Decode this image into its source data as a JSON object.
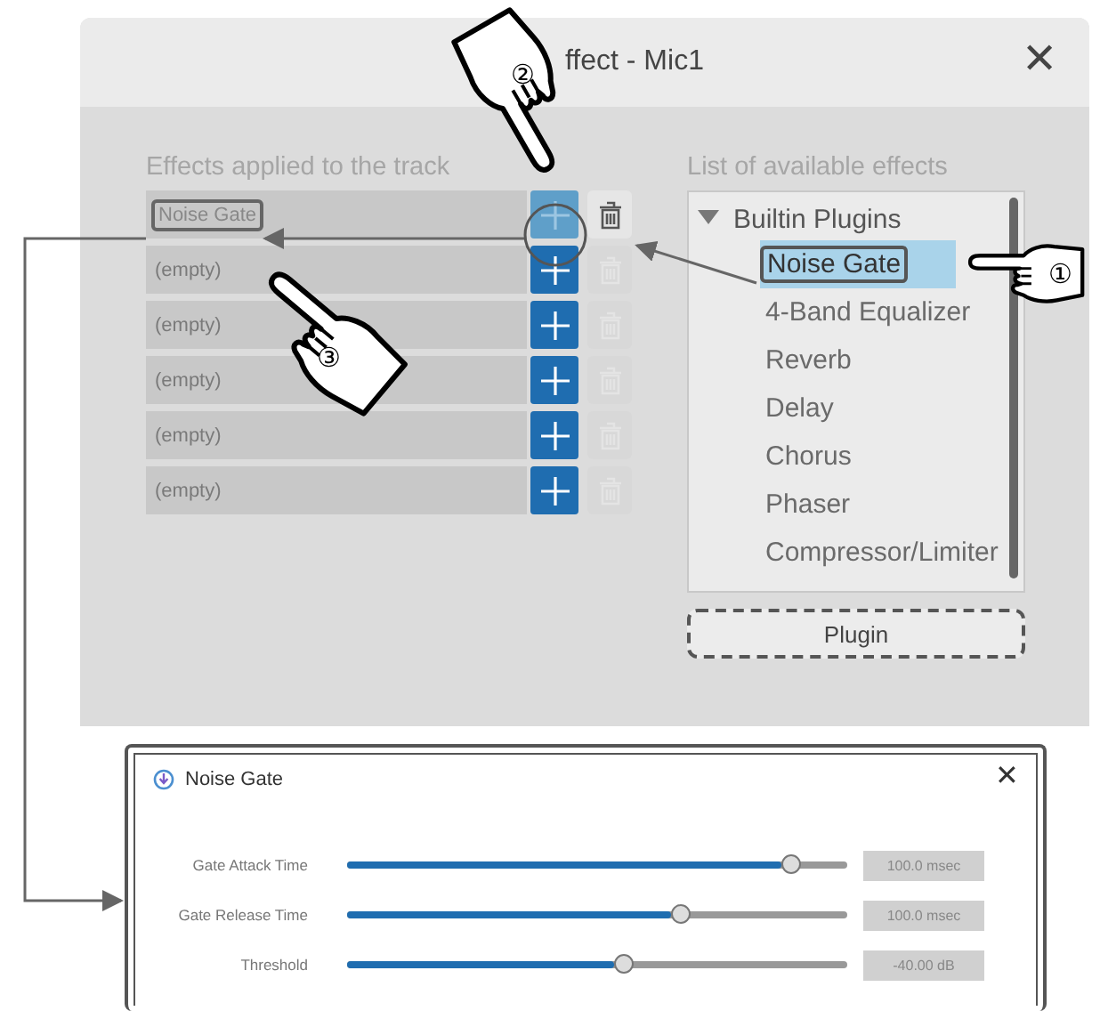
{
  "dialog": {
    "title": "ffect - Mic1",
    "close_button": "✕",
    "applied_heading": "Effects applied to the track",
    "available_heading": "List of available effects",
    "applied": [
      {
        "text": "Noise Gate",
        "filled": true,
        "add_highlighted": true
      },
      {
        "text": "(empty)",
        "filled": false,
        "add_highlighted": false
      },
      {
        "text": "(empty)",
        "filled": false,
        "add_highlighted": false
      },
      {
        "text": "(empty)",
        "filled": false,
        "add_highlighted": false
      },
      {
        "text": "(empty)",
        "filled": false,
        "add_highlighted": false
      },
      {
        "text": "(empty)",
        "filled": false,
        "add_highlighted": false
      }
    ],
    "group": {
      "label": "Builtin Plugins",
      "expanded": true
    },
    "effects": [
      {
        "name": "Noise Gate",
        "selected": true
      },
      {
        "name": "4-Band Equalizer",
        "selected": false
      },
      {
        "name": "Reverb",
        "selected": false
      },
      {
        "name": "Delay",
        "selected": false
      },
      {
        "name": "Chorus",
        "selected": false
      },
      {
        "name": "Phaser",
        "selected": false
      },
      {
        "name": "Compressor/Limiter",
        "selected": false
      }
    ],
    "plugin_button": "Plugin"
  },
  "effect_window": {
    "title": "Noise Gate",
    "close_button": "✕",
    "params": [
      {
        "name": "Gate Attack Time",
        "level": 0.89,
        "reading": "100.0 msec"
      },
      {
        "name": "Gate Release Time",
        "level": 0.67,
        "reading": "100.0 msec"
      },
      {
        "name": "Threshold",
        "level": 0.555,
        "reading": "-40.00 dB"
      }
    ]
  },
  "steps": [
    {
      "number": "①"
    },
    {
      "number": "②"
    },
    {
      "number": "③"
    }
  ]
}
